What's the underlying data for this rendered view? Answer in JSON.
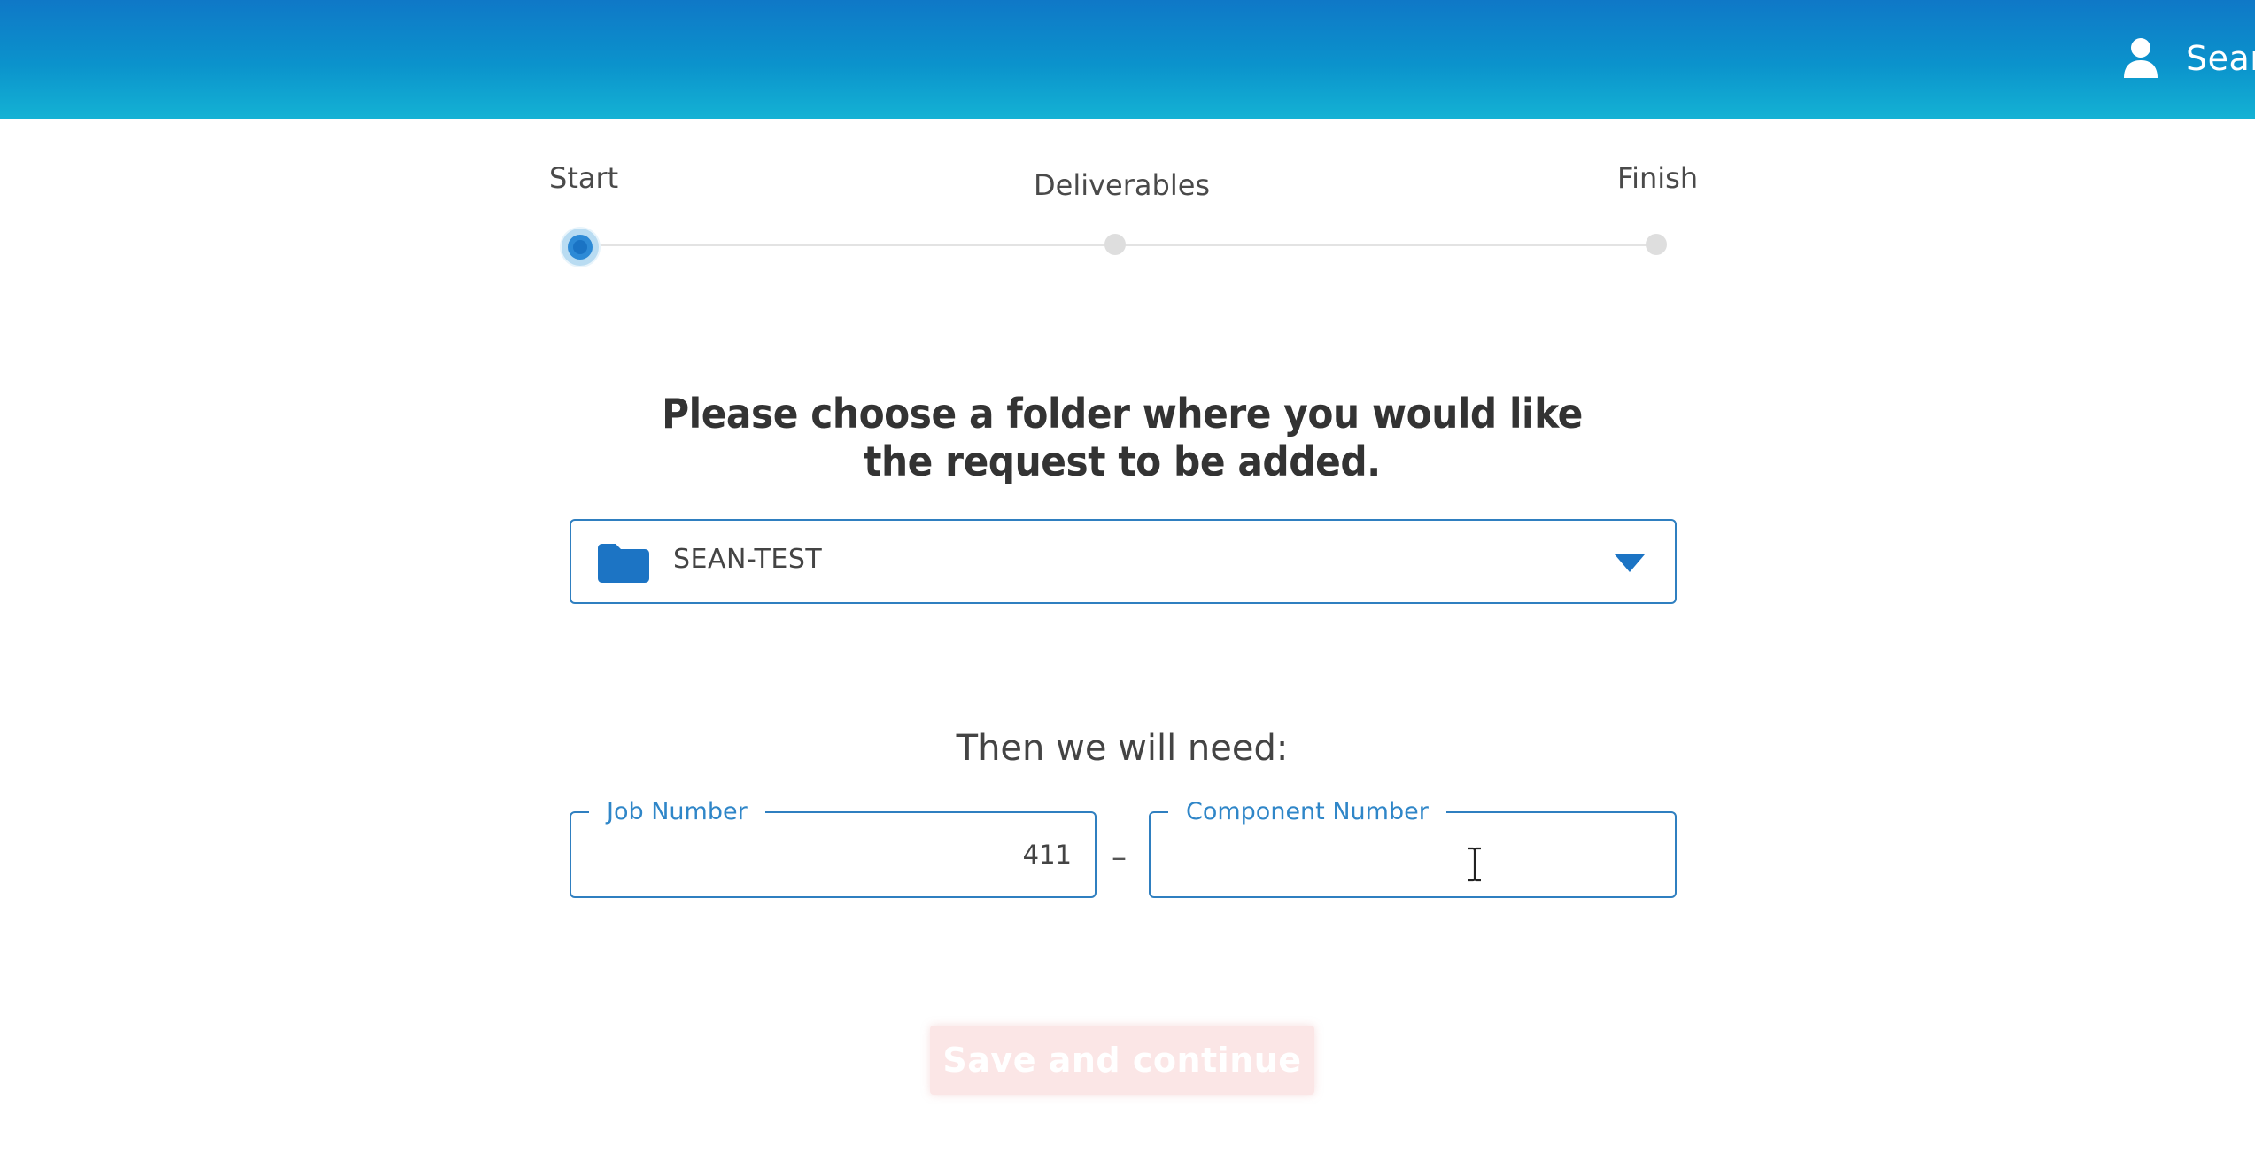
{
  "header": {
    "user_name": "Sear",
    "user_icon": "user-icon"
  },
  "stepper": {
    "steps": [
      {
        "label": "Start",
        "state": "active"
      },
      {
        "label": "Deliverables",
        "state": "inactive"
      },
      {
        "label": "Finish",
        "state": "inactive"
      }
    ]
  },
  "folder": {
    "prompt": "Please choose a folder where you would like the request to be added.",
    "selected": "SEAN-TEST",
    "icon": "folder-icon"
  },
  "identifiers": {
    "intro": "Then we will need:",
    "job_number": {
      "label": "Job Number",
      "value": "411"
    },
    "separator": "–",
    "component_number": {
      "label": "Component Number",
      "value": ""
    }
  },
  "actions": {
    "save_label": "Save and continue",
    "save_enabled": false
  },
  "colors": {
    "header_top": "#0f78c7",
    "header_bottom": "#14b2d4",
    "accent": "#2f7fc0",
    "legend": "#2f86c8",
    "save_disabled_bg": "#fbe6e6"
  }
}
